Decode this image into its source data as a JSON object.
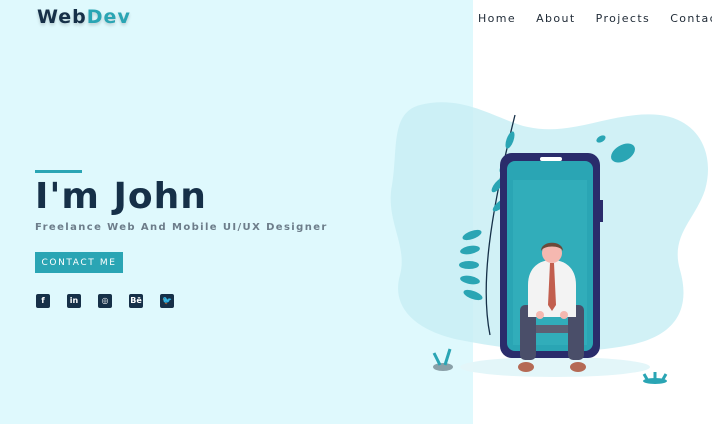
{
  "logo": {
    "part1": "Web",
    "part2": "Dev"
  },
  "nav": {
    "home": "Home",
    "about": "About",
    "projects": "Projects",
    "contact": "Contact"
  },
  "hero": {
    "title": "I'm John",
    "subtitle": "Freelance Web And Mobile UI/UX Designer",
    "cta": "CONTACT ME"
  },
  "socials": [
    {
      "icon": "facebook-icon",
      "glyph": "f"
    },
    {
      "icon": "linkedin-icon",
      "glyph": "in"
    },
    {
      "icon": "dribbble-icon",
      "glyph": "◎"
    },
    {
      "icon": "behance-icon",
      "glyph": "Bē"
    },
    {
      "icon": "twitter-icon",
      "glyph": "🐦"
    }
  ],
  "colors": {
    "accent": "#2aa5b4",
    "dark": "#163048",
    "panel": "#dff9fd"
  }
}
